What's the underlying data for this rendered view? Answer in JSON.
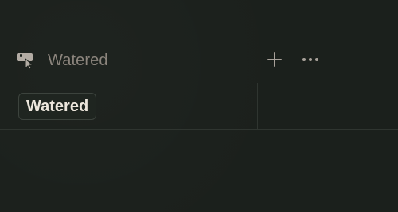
{
  "property": {
    "icon": "watering-can-cursor-icon",
    "title": "Watered"
  },
  "actions": {
    "add_icon": "plus-icon",
    "more_icon": "more-horizontal-icon"
  },
  "row": {
    "tag_label": "Watered"
  },
  "colors": {
    "background": "#1b201c",
    "header_text": "#8c857d",
    "icon": "#b3aca4",
    "tag_text": "#ece6dc",
    "divider": "#2f3530"
  }
}
